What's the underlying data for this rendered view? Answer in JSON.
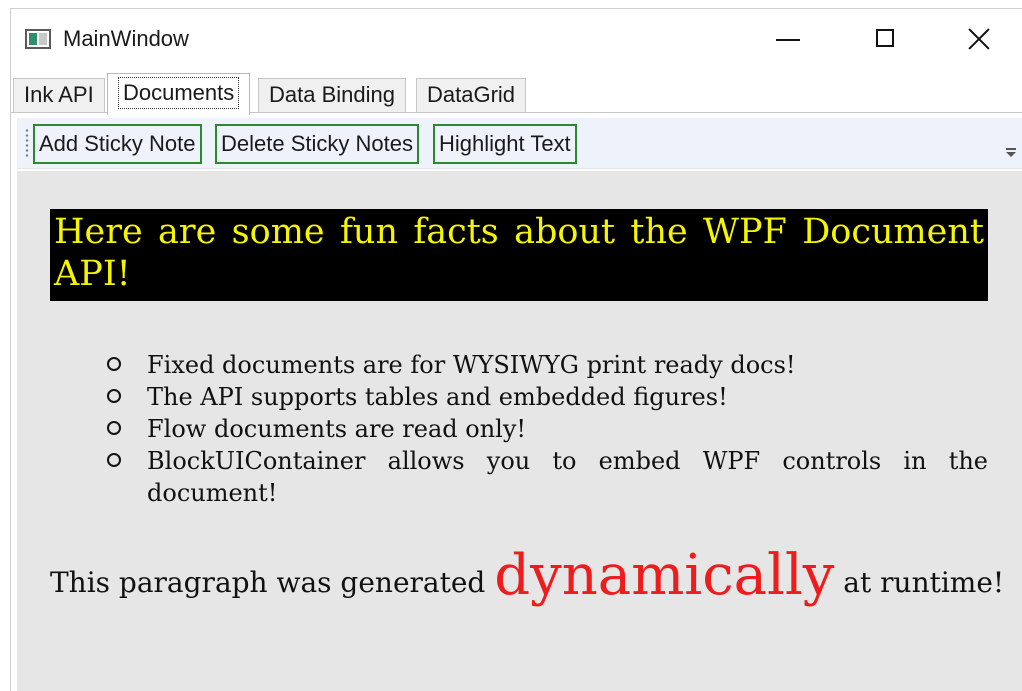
{
  "window": {
    "title": "MainWindow",
    "controls": [
      "minimize-icon",
      "maximize-icon",
      "close-icon"
    ]
  },
  "tabs": [
    {
      "label": "Ink API",
      "active": false
    },
    {
      "label": "Documents",
      "active": true
    },
    {
      "label": "Data Binding",
      "active": false
    },
    {
      "label": "DataGrid",
      "active": false
    }
  ],
  "toolbar": {
    "buttons": [
      "Add Sticky Note",
      "Delete Sticky Notes",
      "Highlight Text"
    ],
    "button_border_color": "#2c8a2c"
  },
  "document": {
    "heading": "Here are some fun facts about the WPF Document API!",
    "heading_colors": {
      "background": "#000000",
      "text": "#f5f500"
    },
    "facts": [
      "Fixed documents are for WYSIWYG print ready docs!",
      "The API supports tables and embedded figures!",
      "Flow documents are read only!",
      "BlockUIContainer allows you to embed WPF controls in the document!"
    ],
    "paragraph": {
      "before": "This paragraph was generated ",
      "highlight": "dynamically",
      "after": " at runtime!",
      "highlight_color": "#ee1c1c"
    }
  }
}
